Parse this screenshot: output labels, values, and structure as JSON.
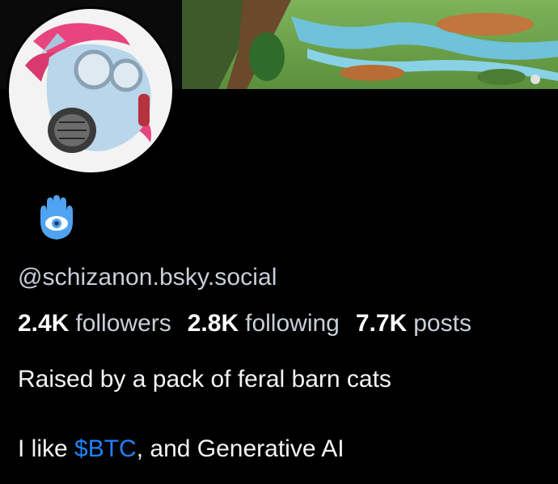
{
  "profile": {
    "handle": "@schizanon.bsky.social",
    "avatar_icon": "gas-mask-unicorn-avatar",
    "emoji_icon": "hamsa-eye-icon"
  },
  "stats": {
    "followers_count": "2.4K",
    "followers_label": "followers",
    "following_count": "2.8K",
    "following_label": "following",
    "posts_count": "7.7K",
    "posts_label": "posts"
  },
  "bio": {
    "line1": "Raised by a pack of feral barn cats",
    "line2_prefix": "I like ",
    "cashtag": "$BTC",
    "line2_suffix": ", and Generative AI"
  },
  "colors": {
    "background": "#000000",
    "muted_text": "#c7cfd9",
    "link": "#1e84ff",
    "emoji_blue": "#4fa3f0"
  }
}
